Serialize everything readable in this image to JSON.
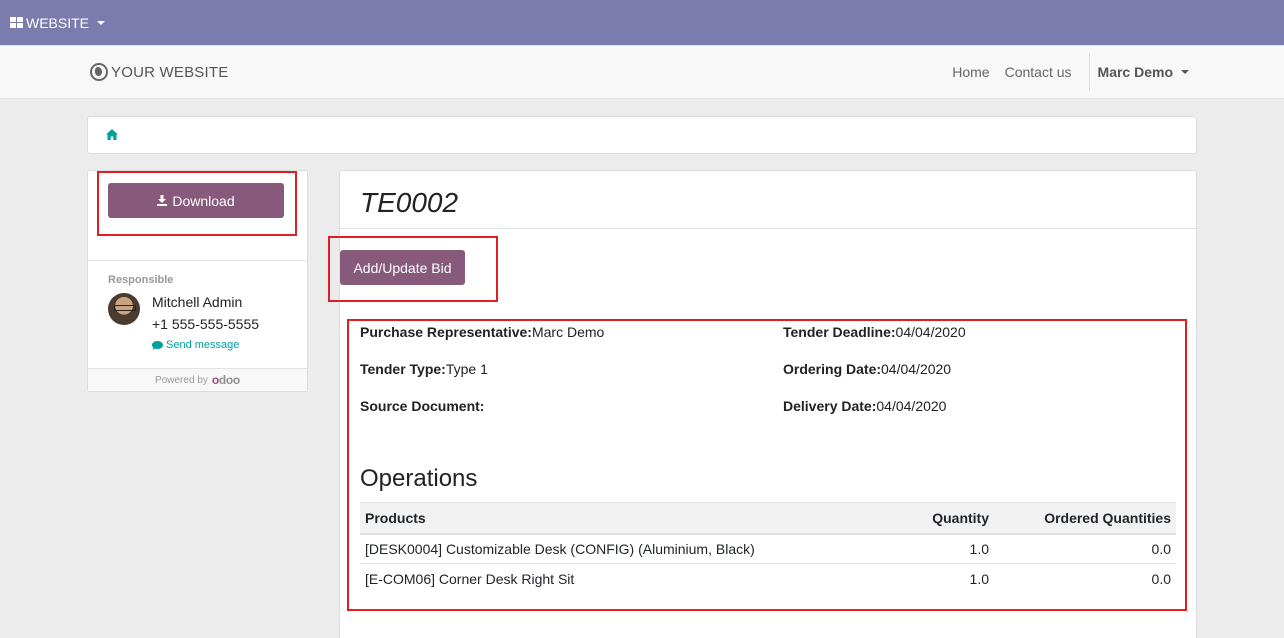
{
  "topbar": {
    "menu_label": "WEBSITE",
    "bg_color": "#7c7bad"
  },
  "navbar": {
    "brand": "YOUR WEBSITE",
    "links": [
      "Home",
      "Contact us"
    ],
    "user": "Marc Demo"
  },
  "breadcrumb": {
    "icon": "home-icon"
  },
  "sidebar": {
    "download_label": "Download",
    "responsible_label": "Responsible",
    "responsible_name": "Mitchell Admin",
    "responsible_phone": "+1 555-555-5555",
    "send_message": "Send message",
    "powered_by": "Powered by",
    "powered_logo_a": "o",
    "powered_logo_b": "doo"
  },
  "tender": {
    "title": "TE0002",
    "bid_button": "Add/Update Bid",
    "fields": {
      "purchase_rep_label": "Purchase Representative:",
      "purchase_rep_value": "Marc Demo",
      "tender_type_label": "Tender Type:",
      "tender_type_value": "Type 1",
      "source_doc_label": "Source Document:",
      "source_doc_value": "",
      "deadline_label": "Tender Deadline:",
      "deadline_value": "04/04/2020",
      "ordering_label": "Ordering Date:",
      "ordering_value": "04/04/2020",
      "delivery_label": "Delivery Date:",
      "delivery_value": "04/04/2020"
    },
    "operations_title": "Operations",
    "table": {
      "headers": [
        "Products",
        "Quantity",
        "Ordered Quantities"
      ],
      "rows": [
        [
          "[DESK0004] Customizable Desk (CONFIG) (Aluminium, Black)",
          "1.0",
          "0.0"
        ],
        [
          "[E-COM06] Corner Desk Right Sit",
          "1.0",
          "0.0"
        ]
      ]
    }
  },
  "colors": {
    "primary_button": "#875a7b",
    "accent": "#00a09d",
    "highlight": "#e31d23"
  }
}
